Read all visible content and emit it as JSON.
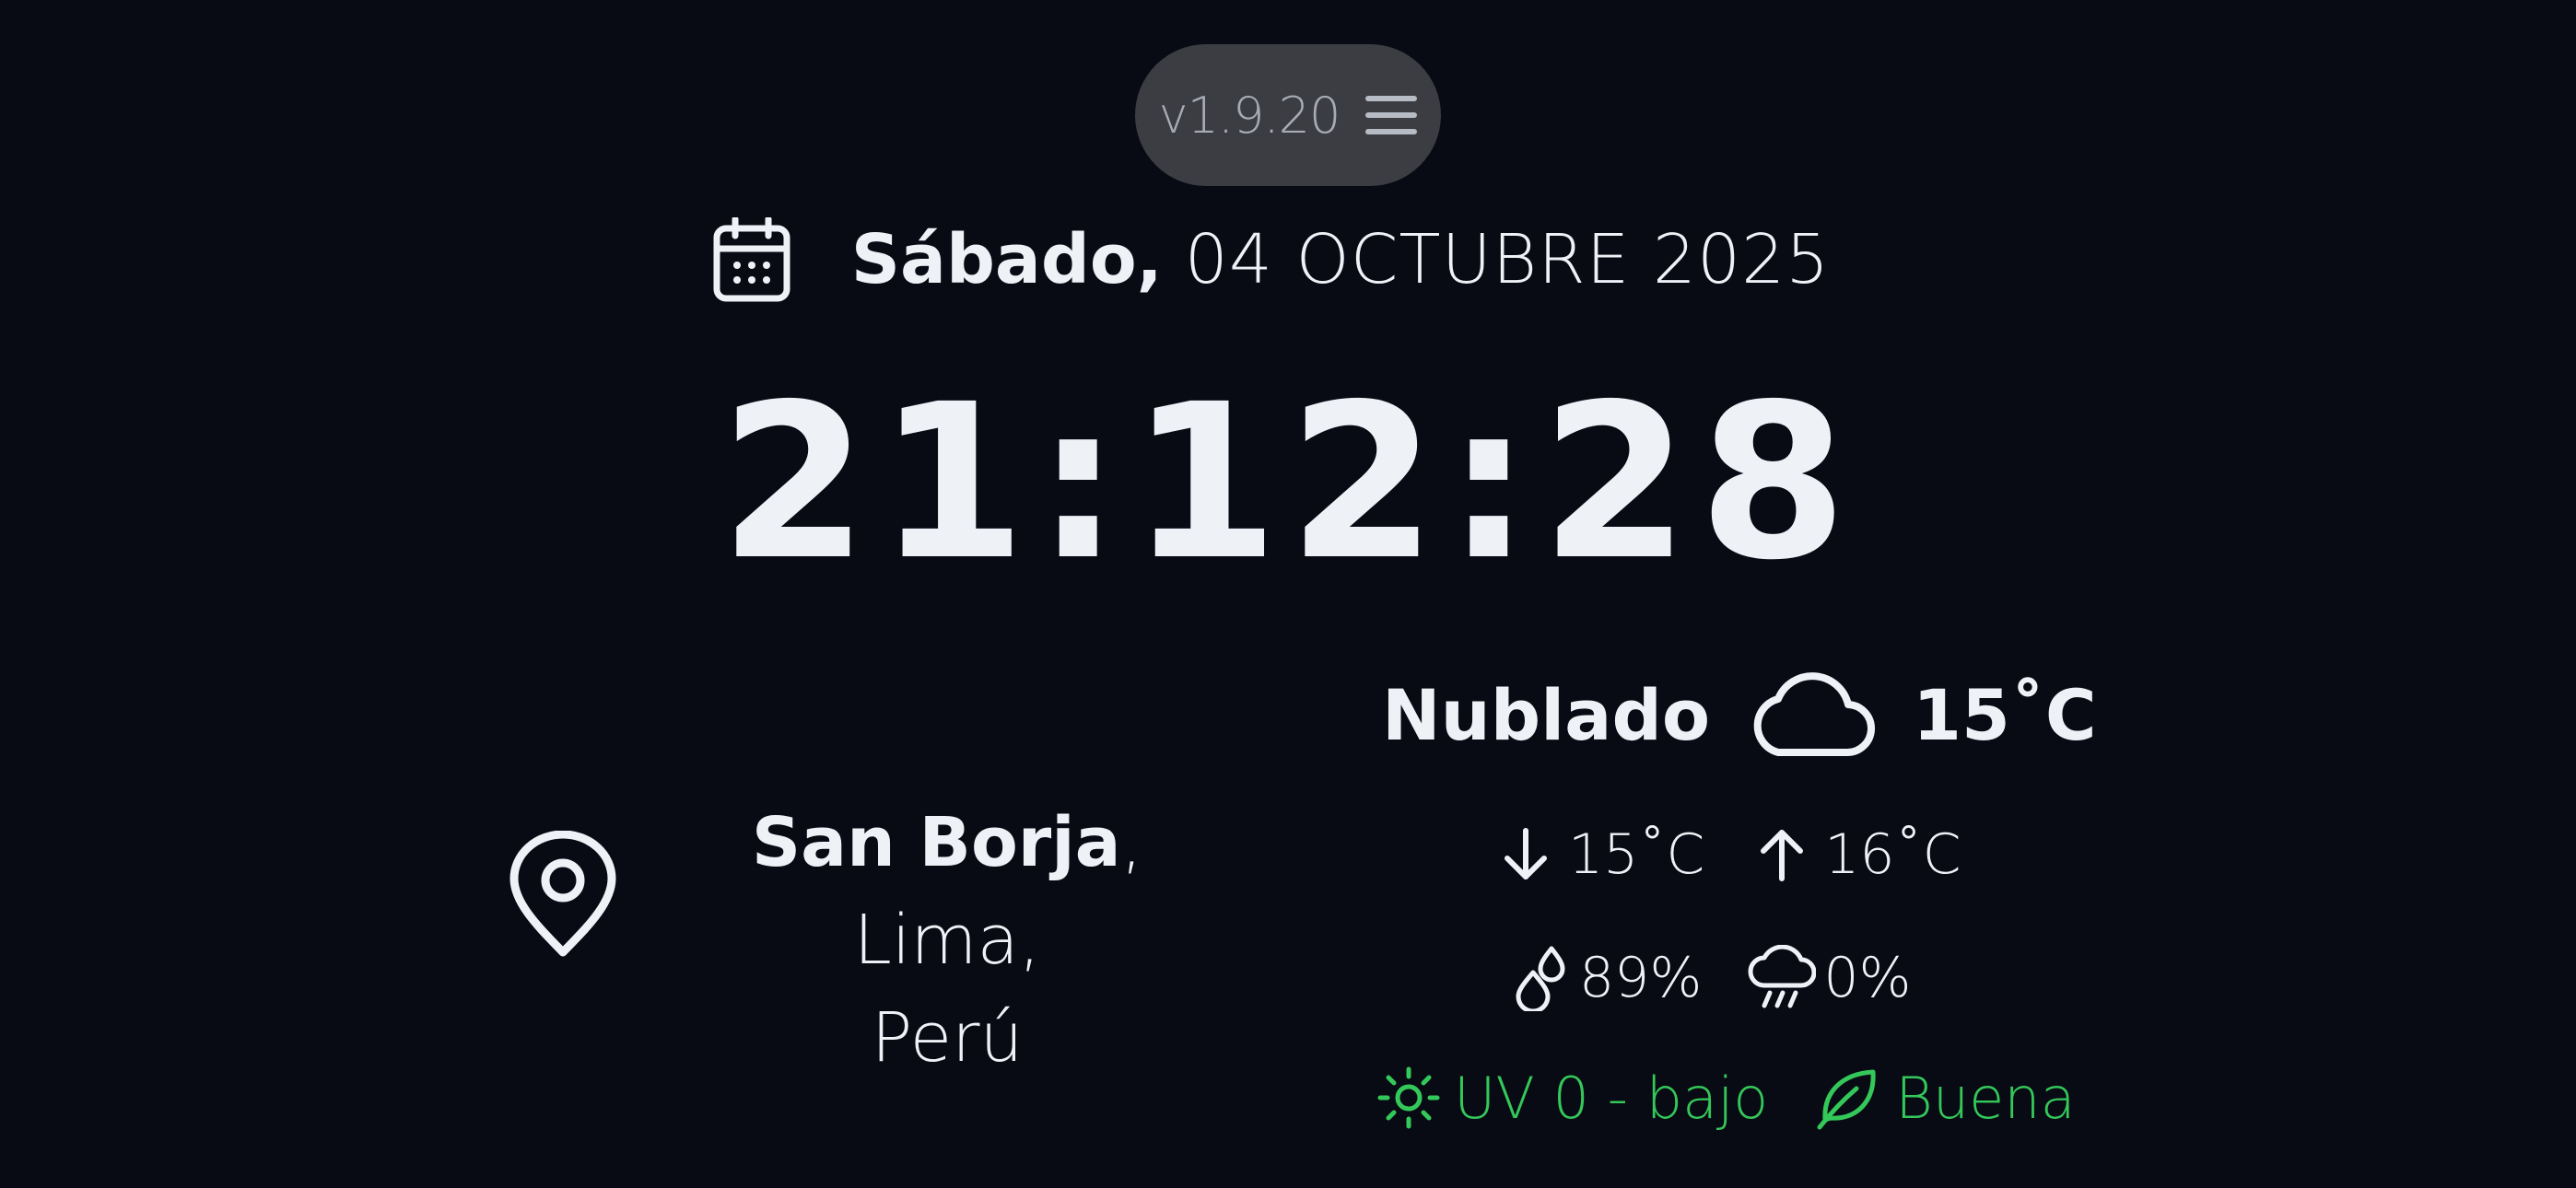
{
  "header": {
    "version": "v1.9.20",
    "menu_icon": "hamburger-menu-icon"
  },
  "date": {
    "icon": "calendar-icon",
    "weekday": "Sábado,",
    "rest": "04 OCTUBRE 2025"
  },
  "clock": {
    "time": "21:12:28"
  },
  "location": {
    "icon": "map-pin-icon",
    "city": "San Borja",
    "rest_line1": ", Lima,",
    "rest_line2": "Perú"
  },
  "weather": {
    "condition": "Nublado",
    "condition_icon": "cloud-icon",
    "temperature": "15˚C",
    "min_temp": "15˚C",
    "max_temp": "16˚C",
    "humidity": "89%",
    "precipitation": "0%",
    "uv": "UV 0 - bajo",
    "air_quality": "Buena"
  },
  "colors": {
    "background": "#080b13",
    "text": "#eef1f6",
    "pill": "#3b3d43",
    "accent_green": "#34c759"
  }
}
